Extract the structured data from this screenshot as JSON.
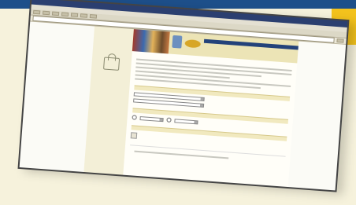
{
  "colors": {
    "top_bar": "#1d4f8a",
    "accent": "#f3c21c",
    "page_bg": "#f6f2dc",
    "sidebar_bg": "#f3efd7",
    "section_bg": "#f1e9bf"
  },
  "browser": {
    "title": "",
    "menu": [
      "",
      "",
      "",
      "",
      "",
      ""
    ],
    "address": ""
  },
  "sidebar": {
    "logo_icon": "building-icon",
    "links": [
      "",
      "",
      "",
      "",
      "",
      ""
    ]
  },
  "main": {
    "page_title": "",
    "sections": [
      {
        "label": "",
        "link": ""
      },
      {
        "label": "",
        "link": ""
      },
      {
        "label": "",
        "link": ""
      }
    ],
    "fields": {
      "select_1": "",
      "select_2": "",
      "select_3": "",
      "select_4": ""
    },
    "search_button": ""
  }
}
